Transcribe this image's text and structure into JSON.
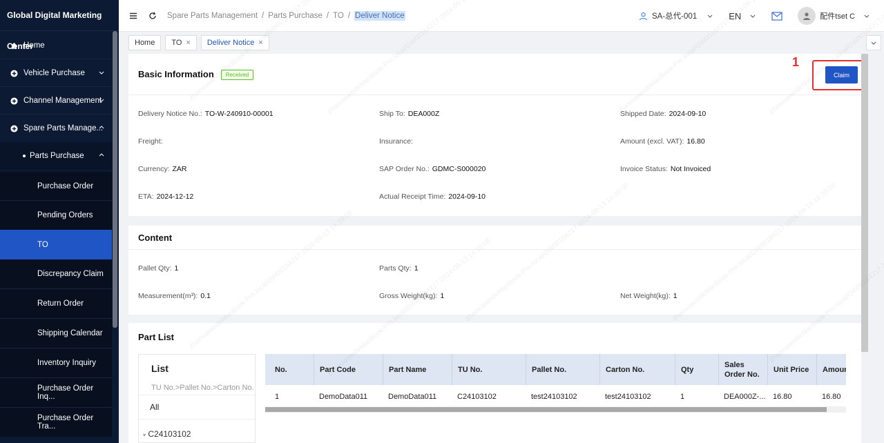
{
  "app": {
    "title": "Global Digital Marketing Center"
  },
  "sidebar": {
    "items": [
      {
        "label": "Home",
        "icon": "home-icon"
      },
      {
        "label": "Vehicle Purchase",
        "icon": "plus-circle-icon"
      },
      {
        "label": "Channel Management",
        "icon": "plus-circle-icon"
      },
      {
        "label": "Spare Parts Manage...",
        "icon": "plus-circle-icon"
      },
      {
        "label": "Parts Purchase"
      },
      {
        "label": "Purchase Order"
      },
      {
        "label": "Pending Orders"
      },
      {
        "label": "TO"
      },
      {
        "label": "Discrepancy Claim"
      },
      {
        "label": "Return Order"
      },
      {
        "label": "Shipping Calendar"
      },
      {
        "label": "Inventory Inquiry"
      },
      {
        "label": "Purchase Order Inq..."
      },
      {
        "label": "Purchase Order Tra..."
      }
    ]
  },
  "header": {
    "breadcrumb": [
      "Spare Parts Management",
      "Parts Purchase",
      "TO",
      "Deliver Notice"
    ],
    "user": "SA-总代-001",
    "lang": "EN",
    "account": "配件tset C"
  },
  "tabs": [
    {
      "label": "Home"
    },
    {
      "label": "TO"
    },
    {
      "label": "Deliver Notice"
    }
  ],
  "basic": {
    "title": "Basic Information",
    "status": "Received",
    "claim_label": "Claim",
    "step_marker": "1",
    "fields": {
      "delivery_notice_no": {
        "label": "Delivery Notice No.:",
        "value": "TO-W-240910-00001"
      },
      "ship_to": {
        "label": "Ship To:",
        "value": "DEA000Z"
      },
      "shipped_date": {
        "label": "Shipped Date:",
        "value": "2024-09-10"
      },
      "freight": {
        "label": "Freight:",
        "value": ""
      },
      "insurance": {
        "label": "Insurance:",
        "value": ""
      },
      "amount": {
        "label": "Amount (excl. VAT):",
        "value": "16.80"
      },
      "currency": {
        "label": "Currency:",
        "value": "ZAR"
      },
      "sap_order": {
        "label": "SAP Order No.:",
        "value": "GDMC-S000020"
      },
      "invoice_status": {
        "label": "Invoice Status:",
        "value": "Not Invoiced"
      },
      "eta": {
        "label": "ETA:",
        "value": "2024-12-12"
      },
      "actual_receipt": {
        "label": "Actual Receipt Time:",
        "value": "2024-09-10"
      }
    }
  },
  "content": {
    "title": "Content",
    "fields": {
      "pallet_qty": {
        "label": "Pallet Qty:",
        "value": "1"
      },
      "parts_qty": {
        "label": "Parts Qty:",
        "value": "1"
      },
      "measurement": {
        "label": "Measurement(m³):",
        "value": "0.1"
      },
      "gross_weight": {
        "label": "Gross Weight(kg):",
        "value": "1"
      },
      "net_weight": {
        "label": "Net Weight(kg):",
        "value": "1"
      }
    }
  },
  "part_list": {
    "title": "Part List",
    "list_title": "List",
    "list_sub": "TU No.>Pallet No.>Carton No.",
    "list_all": "All",
    "list_node": "C24103102",
    "columns": [
      "No.",
      "Part Code",
      "Part Name",
      "TU No.",
      "Pallet No.",
      "Carton No.",
      "Qty",
      "Sales Order No.",
      "Unit Price",
      "Amount"
    ],
    "rows": [
      [
        "1",
        "DemoData011",
        "DemoData011",
        "C24103102",
        "test24103102",
        "test24103102",
        "1",
        "DEA000Z-...",
        "16.80",
        "16.80"
      ]
    ]
  },
  "watermark": "zhaoxiaweideMacBook-Pro.local/GW00164217 2024-09-13 14:39:08"
}
